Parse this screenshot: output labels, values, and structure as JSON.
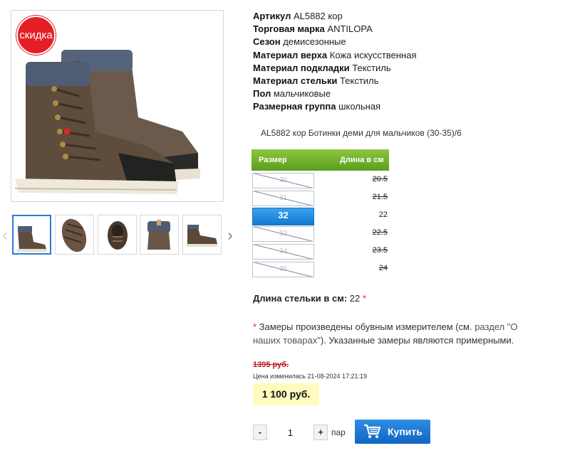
{
  "product": {
    "sale_badge": "скидка",
    "title": "AL5882 кор Ботинки деми для мальчиков (30-35)/6"
  },
  "specs": [
    {
      "key": "Артикул",
      "value": "AL5882 кор"
    },
    {
      "key": "Торговая марка",
      "value": "ANTILOPA"
    },
    {
      "key": "Сезон",
      "value": "демисезонные"
    },
    {
      "key": "Материал верха",
      "value": "Кожа искусственная"
    },
    {
      "key": "Материал подкладки",
      "value": "Текстиль"
    },
    {
      "key": "Материал стельки",
      "value": "Текстиль"
    },
    {
      "key": "Пол",
      "value": "мальчиковые"
    },
    {
      "key": "Размерная группа",
      "value": "школьная"
    }
  ],
  "size_table": {
    "header_size": "Размер",
    "header_length": "Длина в см",
    "rows": [
      {
        "size": "30",
        "length": "20.5",
        "available": false
      },
      {
        "size": "31",
        "length": "21.5",
        "available": false
      },
      {
        "size": "32",
        "length": "22",
        "available": true,
        "selected": true
      },
      {
        "size": "33",
        "length": "22.5",
        "available": false
      },
      {
        "size": "34",
        "length": "23.5",
        "available": false
      },
      {
        "size": "35",
        "length": "24",
        "available": false
      }
    ]
  },
  "insole": {
    "label": "Длина стельки в см:",
    "value": "22",
    "star": "*"
  },
  "note": {
    "star": "*",
    "text_before": " Замеры произведены обувным измерителем (см. ",
    "link": "раздел \"О наших товарах\"",
    "text_after": "). Указанные замеры являются примерными."
  },
  "price": {
    "old": "1395 руб.",
    "changed": "Цена изменилась 21-08-2024 17:21:19",
    "current": "1 100 руб."
  },
  "purchase": {
    "minus": "-",
    "quantity": "1",
    "plus": "+",
    "unit": "пар",
    "buy_label": "Купить"
  },
  "gallery": {
    "prev_icon": "chevron-left-icon",
    "next_icon": "chevron-right-icon",
    "thumbnails": [
      "boots-side-view",
      "sole-view",
      "top-view",
      "back-view",
      "boot-profile-view"
    ]
  }
}
